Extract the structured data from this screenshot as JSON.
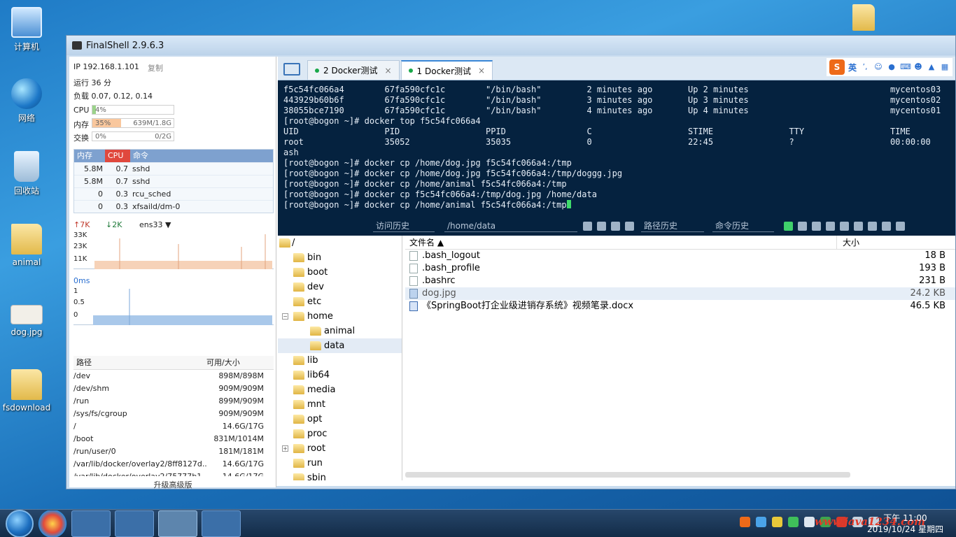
{
  "desktop": {
    "icons": [
      "计算机",
      "网络",
      "回收站",
      "animal",
      "dog.jpg",
      "fsdownload"
    ]
  },
  "window": {
    "title": "FinalShell 2.9.6.3"
  },
  "server": {
    "ip": "IP 192.168.1.101",
    "copy": "复制",
    "uptime": "运行 36 分",
    "load": "负载 0.07, 0.12, 0.14",
    "cpu_label": "CPU",
    "cpu_value": "4%",
    "mem_label": "内存",
    "mem_percent": "35%",
    "mem_value": "639M/1.8G",
    "swap_label": "交换",
    "swap_percent": "0%",
    "swap_value": "0/2G"
  },
  "process_table": {
    "headers": [
      "内存",
      "CPU",
      "命令"
    ],
    "rows": [
      [
        "5.8M",
        "0.7",
        "sshd"
      ],
      [
        "5.8M",
        "0.7",
        "sshd"
      ],
      [
        "0",
        "0.3",
        "rcu_sched"
      ],
      [
        "0",
        "0.3",
        "xfsaild/dm-0"
      ]
    ]
  },
  "network": {
    "up": "7K",
    "down": "2K",
    "interface": "ens33",
    "scale": [
      "33K",
      "23K",
      "11K"
    ],
    "latency": "0ms",
    "latency_scale": [
      "1",
      "0.5",
      "0"
    ]
  },
  "disk_table": {
    "headers": [
      "路径",
      "可用/大小"
    ],
    "rows": [
      [
        "/dev",
        "898M/898M"
      ],
      [
        "/dev/shm",
        "909M/909M"
      ],
      [
        "/run",
        "899M/909M"
      ],
      [
        "/sys/fs/cgroup",
        "909M/909M"
      ],
      [
        "/",
        "14.6G/17G"
      ],
      [
        "/boot",
        "831M/1014M"
      ],
      [
        "/run/user/0",
        "181M/181M"
      ],
      [
        "/var/lib/docker/overlay2/8ff8127d...",
        "14.6G/17G"
      ],
      [
        "/var/lib/docker/overlay2/75777b1...",
        "14.6G/17G"
      ]
    ]
  },
  "upgrade": "升级高级版",
  "tabs": [
    {
      "label": "2 Docker测试",
      "close": "×"
    },
    {
      "label": "1 Docker测试",
      "close": "×"
    }
  ],
  "ime": {
    "lang": "英"
  },
  "terminal": {
    "lines": [
      "f5c54fc066a4        67fa590cfc1c        \"/bin/bash\"         2 minutes ago       Up 2 minutes                            mycentos03",
      "443929b60b6f        67fa590cfc1c        \"/bin/bash\"         3 minutes ago       Up 3 minutes                            mycentos02",
      "38055bce7190        67fa590cfc1c        \"/bin/bash\"         4 minutes ago       Up 4 minutes                            mycentos01",
      "[root@bogon ~]# docker top f5c54fc066a4",
      "UID                 PID                 PPID                C                   STIME               TTY                 TIME",
      "root                35052               35035               0                   22:45               ?                   00:00:00",
      "ash",
      "[root@bogon ~]# docker cp /home/dog.jpg f5c54fc066a4:/tmp",
      "[root@bogon ~]# docker cp /home/dog.jpg f5c54fc066a4:/tmp/doggg.jpg",
      "[root@bogon ~]# docker cp /home/animal f5c54fc066a4:/tmp",
      "[root@bogon ~]# docker cp f5c54fc066a4:/tmp/dog.jpg /home/data"
    ],
    "current_line": "[root@bogon ~]# docker cp /home/animal f5c54fc066a4:/tmp"
  },
  "termbar": {
    "history": "访问历史",
    "path": "/home/data",
    "path_history": "路径历史",
    "cmd_history": "命令历史"
  },
  "tree": {
    "root": "/",
    "nodes": [
      "bin",
      "boot",
      "dev",
      "etc",
      "home",
      "animal",
      "data",
      "lib",
      "lib64",
      "media",
      "mnt",
      "opt",
      "proc",
      "root",
      "run",
      "sbin"
    ]
  },
  "files": {
    "headers": [
      "文件名",
      "大小"
    ],
    "rows": [
      {
        "name": ".bash_logout",
        "size": "18 B"
      },
      {
        "name": ".bash_profile",
        "size": "193 B"
      },
      {
        "name": ".bashrc",
        "size": "231 B"
      },
      {
        "name": "dog.jpg",
        "size": "24.2 KB"
      },
      {
        "name": "《SpringBoot打企业级进销存系统》视频笔录.docx",
        "size": "46.5 KB"
      }
    ]
  },
  "taskbar": {
    "watermark": "www.java1234.com",
    "time": "下午 11:00",
    "date": "2019/10/24 星期四"
  }
}
